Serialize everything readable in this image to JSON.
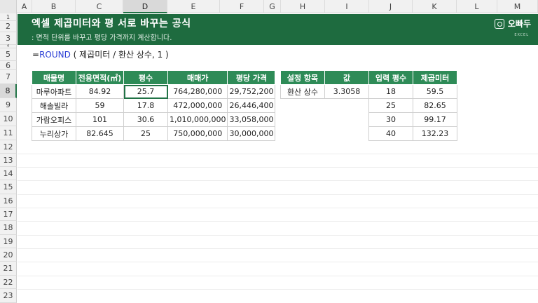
{
  "columns": [
    "A",
    "B",
    "C",
    "D",
    "E",
    "F",
    "G",
    "H",
    "I",
    "J",
    "K",
    "L",
    "M"
  ],
  "selected_column": "D",
  "rows": [
    "1",
    "2",
    "3",
    "4",
    "5",
    "6",
    "7",
    "8",
    "9",
    "10",
    "11",
    "12",
    "13",
    "14",
    "15",
    "16",
    "17",
    "18",
    "19",
    "20",
    "21",
    "22",
    "23"
  ],
  "selected_row": "8",
  "banner": {
    "title": "엑셀 제곱미터와 평 서로 바꾸는 공식",
    "subtitle": ": 면적 단위를 바꾸고 평당 가격까지 계산합니다.",
    "logo_text": "오빠두",
    "logo_sub": "EXCEL"
  },
  "formula": {
    "prefix": "=",
    "fn": "ROUND",
    "rest": " ( 제곱미터 / 환산 상수, 1 )"
  },
  "table_main": {
    "headers": [
      "매물명",
      "전용면적(㎡)",
      "평수",
      "매매가",
      "평당 가격"
    ],
    "rows": [
      [
        "마루아파트",
        "84.92",
        "25.7",
        "764,280,000",
        "29,752,200"
      ],
      [
        "해솔빌라",
        "59",
        "17.8",
        "472,000,000",
        "26,446,400"
      ],
      [
        "가람오피스",
        "101",
        "30.6",
        "1,010,000,000",
        "33,058,000"
      ],
      [
        "누리상가",
        "82.645",
        "25",
        "750,000,000",
        "30,000,000"
      ]
    ]
  },
  "table_setting": {
    "headers": [
      "설정 항목",
      "값"
    ],
    "rows": [
      [
        "환산 상수",
        "3.3058"
      ]
    ]
  },
  "table_convert": {
    "headers": [
      "입력 평수",
      "제곱미터"
    ],
    "rows": [
      [
        "18",
        "59.5"
      ],
      [
        "25",
        "82.65"
      ],
      [
        "30",
        "99.17"
      ],
      [
        "40",
        "132.23"
      ]
    ]
  },
  "colors": {
    "banner": "#1e6b3f",
    "header": "#2e8b57",
    "selection": "#217346"
  }
}
